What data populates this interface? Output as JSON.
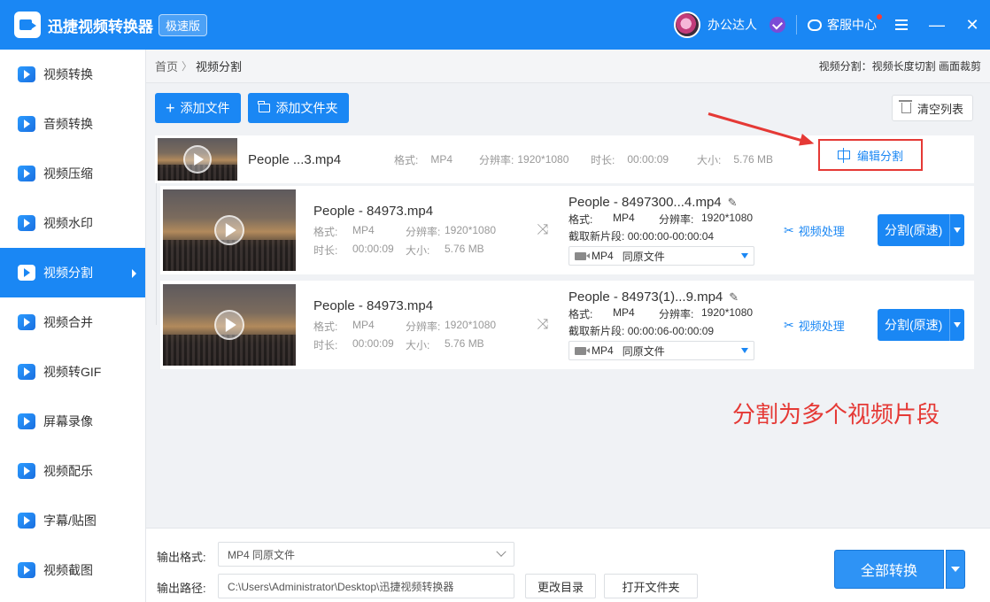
{
  "titlebar": {
    "app_title": "迅捷视频转换器",
    "edition": "极速版",
    "user_name": "办公达人",
    "service": "客服中心",
    "minimize": "—",
    "close": "✕"
  },
  "sidebar": {
    "items": [
      {
        "label": "视频转换"
      },
      {
        "label": "音频转换"
      },
      {
        "label": "视频压缩"
      },
      {
        "label": "视频水印"
      },
      {
        "label": "视频分割"
      },
      {
        "label": "视频合并"
      },
      {
        "label": "视频转GIF"
      },
      {
        "label": "屏幕录像"
      },
      {
        "label": "视频配乐"
      },
      {
        "label": "字幕/贴图"
      },
      {
        "label": "视频截图"
      }
    ],
    "active_index": 4
  },
  "breadcrumb": {
    "home": "首页",
    "sep": "〉",
    "current": "视频分割",
    "hint": "视频分割：视频长度切割 画面裁剪"
  },
  "toolbar": {
    "add_file": "添加文件",
    "add_folder": "添加文件夹",
    "clear_list": "清空列表"
  },
  "file": {
    "name": "People ...3.mp4",
    "format_label": "格式:",
    "format": "MP4",
    "resolution_label": "分辨率:",
    "resolution": "1920*1080",
    "duration_label": "时长:",
    "duration": "00:00:09",
    "size_label": "大小:",
    "size": "5.76 MB",
    "edit_split": "编辑分割"
  },
  "segments": [
    {
      "src_name": "People - 84973.mp4",
      "format_label": "格式:",
      "format": "MP4",
      "resolution_label": "分辨率:",
      "resolution": "1920*1080",
      "duration_label": "时长:",
      "duration": "00:00:09",
      "size_label": "大小:",
      "size": "5.76 MB",
      "out_name": "People - 8497300...4.mp4",
      "out_format_label": "格式:",
      "out_format": "MP4",
      "out_resolution_label": "分辨率:",
      "out_resolution": "1920*1080",
      "clip_label": "截取新片段:",
      "clip_range": "00:00:00-00:00:04",
      "select_value": "MP4",
      "select_sub": "同原文件",
      "process": "视频处理",
      "split_button": "分割(原速)"
    },
    {
      "src_name": "People - 84973.mp4",
      "format_label": "格式:",
      "format": "MP4",
      "resolution_label": "分辨率:",
      "resolution": "1920*1080",
      "duration_label": "时长:",
      "duration": "00:00:09",
      "size_label": "大小:",
      "size": "5.76 MB",
      "out_name": "People - 84973(1)...9.mp4",
      "out_format_label": "格式:",
      "out_format": "MP4",
      "out_resolution_label": "分辨率:",
      "out_resolution": "1920*1080",
      "clip_label": "截取新片段:",
      "clip_range": "00:00:06-00:00:09",
      "select_value": "MP4",
      "select_sub": "同原文件",
      "process": "视频处理",
      "split_button": "分割(原速)"
    }
  ],
  "annotation": "分割为多个视频片段",
  "bottom": {
    "format_label": "输出格式:",
    "format_value": "MP4  同原文件",
    "path_label": "输出路径:",
    "path_value": "C:\\Users\\Administrator\\Desktop\\迅捷视频转换器",
    "change_dir": "更改目录",
    "open_folder": "打开文件夹",
    "convert_all": "全部转换"
  },
  "colors": {
    "primary": "#1a87f4",
    "annotation": "#e53935"
  }
}
